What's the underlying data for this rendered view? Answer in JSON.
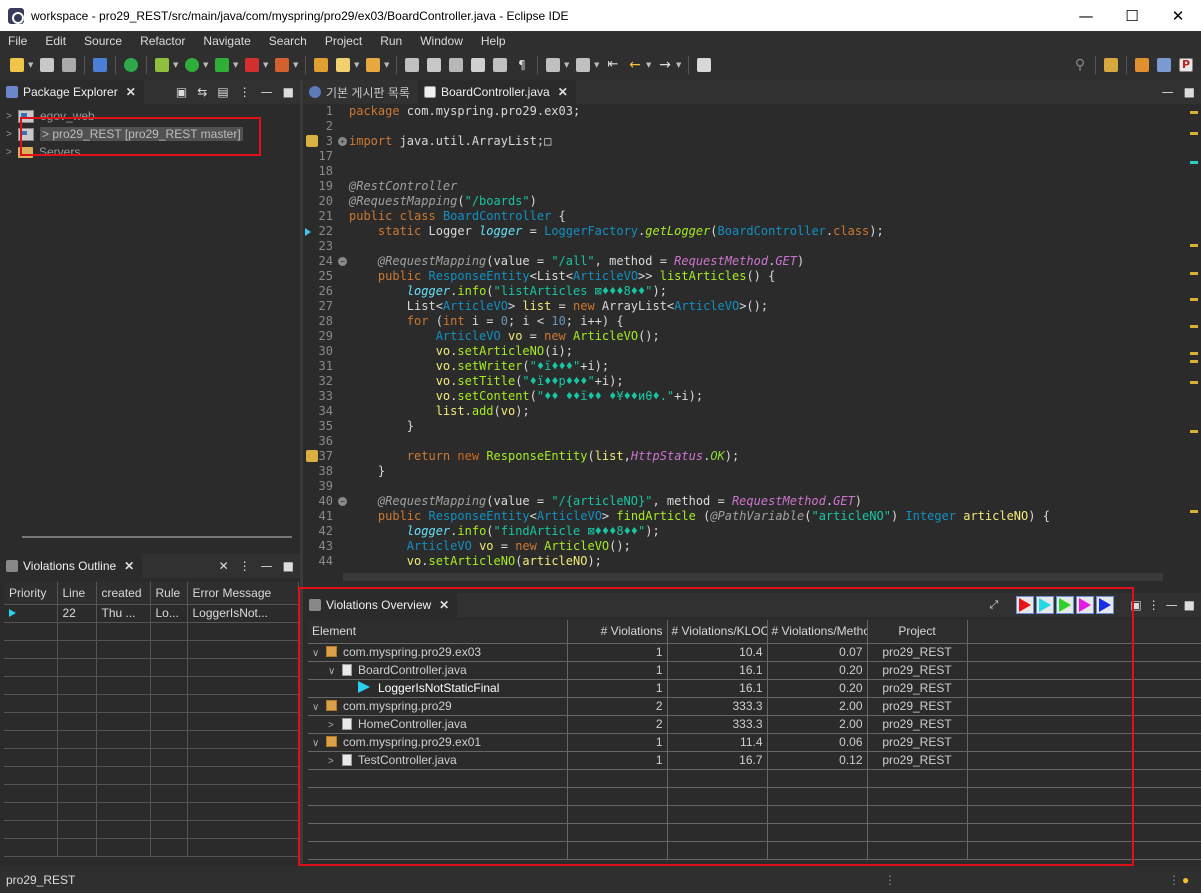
{
  "window": {
    "title": "workspace - pro29_REST/src/main/java/com/myspring/pro29/ex03/BoardController.java - Eclipse IDE",
    "minimize": "—",
    "maximize": "☐",
    "close": "✕"
  },
  "menu": [
    "File",
    "Edit",
    "Source",
    "Refactor",
    "Navigate",
    "Search",
    "Project",
    "Run",
    "Window",
    "Help"
  ],
  "package_explorer": {
    "tab_label": "Package Explorer",
    "items": [
      {
        "label": "egov_web"
      },
      {
        "label": "> pro29_REST [pro29_REST master]"
      },
      {
        "label": "Servers"
      }
    ]
  },
  "violations_outline": {
    "tab_label": "Violations Outline",
    "columns": [
      "Priority",
      "Line",
      "created",
      "Rule",
      "Error Message"
    ],
    "rows": [
      {
        "priority": "",
        "line": "22",
        "created": "Thu ...",
        "rule": "Lo...",
        "message": "LoggerIsNot..."
      }
    ]
  },
  "editor": {
    "tabs": [
      {
        "label": "기본 게시판 목록"
      },
      {
        "label": "BoardController.java"
      }
    ],
    "lines": [
      {
        "n": "1",
        "html": "<span class='kw'>package</span> com.myspring.pro29.ex03;"
      },
      {
        "n": "2",
        "html": ""
      },
      {
        "n": "3",
        "html": "<span class='kw'>import</span> java.util.ArrayList;&#9633;"
      },
      {
        "n": "17",
        "html": ""
      },
      {
        "n": "18",
        "html": ""
      },
      {
        "n": "19",
        "html": "<span class='an'>@RestController</span>"
      },
      {
        "n": "20",
        "html": "<span class='an'>@RequestMapping</span>(<span class='str'>\"/boards\"</span>)"
      },
      {
        "n": "21",
        "html": "<span class='kw'>public</span> <span class='kw'>class</span> <span class='cls'>BoardController</span> {"
      },
      {
        "n": "22",
        "html": "    <span class='kw'>static</span> Logger <span class='fld'>logger</span> = <span class='ty'>LoggerFactory</span>.<span class='mth2'>getLogger</span>(<span class='ty'>BoardController</span>.<span class='kw'>class</span>);"
      },
      {
        "n": "23",
        "html": ""
      },
      {
        "n": "24",
        "html": "    <span class='an'>@RequestMapping</span>(value = <span class='str'>\"/all\"</span>, method = <span class='it'>RequestMethod</span>.<span class='it'>GET</span>)"
      },
      {
        "n": "25",
        "html": "    <span class='kw'>public</span> <span class='ty'>ResponseEntity</span>&lt;List&lt;<span class='ty'>ArticleVO</span>&gt;&gt; <span class='mth'>listArticles</span>() {"
      },
      {
        "n": "26",
        "html": "        <span class='fld'>logger</span>.<span class='mth'>info</span>(<span class='str'>\"listArticles &#8864;&#9830;&#9830;&#9830;8&#9830;&#9830;\"</span>);"
      },
      {
        "n": "27",
        "html": "        List&lt;<span class='ty'>ArticleVO</span>&gt; <span class='var'>list</span> = <span class='kw'>new</span> ArrayList&lt;<span class='ty'>ArticleVO</span>&gt;();"
      },
      {
        "n": "28",
        "html": "        <span class='kw'>for</span> (<span class='kw'>int</span> i = <span class='num'>0</span>; i &lt; <span class='num'>10</span>; i++) {"
      },
      {
        "n": "29",
        "html": "            <span class='ty'>ArticleVO</span> <span class='var'>vo</span> = <span class='kw'>new</span> <span class='mth'>ArticleVO</span>();"
      },
      {
        "n": "30",
        "html": "            <span class='var'>vo</span>.<span class='mth'>setArticleNO</span>(i);"
      },
      {
        "n": "31",
        "html": "            <span class='var'>vo</span>.<span class='mth'>setWriter</span>(<span class='str'>\"&#9830;&#1111;&#9830;&#9830;&#9830;\"</span>+i);"
      },
      {
        "n": "32",
        "html": "            <span class='var'>vo</span>.<span class='mth'>setTitle</span>(<span class='str'>\"&#9830;&#1111;&#9830;&#9830;p&#9830;&#9830;&#9830;\"</span>+i);"
      },
      {
        "n": "33",
        "html": "            <span class='var'>vo</span>.<span class='mth'>setContent</span>(<span class='str'>\"&#9830;&#9830; &#9830;&#9830;&#1111;&#9830;&#9830; &#9830;&#165;&#9830;&#9830;&#1080;&#952;&#9830;.\"</span>+i);"
      },
      {
        "n": "34",
        "html": "            <span class='var'>list</span>.<span class='mth'>add</span>(<span class='var'>vo</span>);"
      },
      {
        "n": "35",
        "html": "        }"
      },
      {
        "n": "36",
        "html": ""
      },
      {
        "n": "37",
        "html": "        <span class='kw'>return</span> <span class='kw2'>new</span> <span class='mth'>ResponseEntity</span>(<span class='var'>list</span>,<span class='it'>HttpStatus</span>.<span class='enum'>OK</span>);"
      },
      {
        "n": "38",
        "html": "    }"
      },
      {
        "n": "39",
        "html": ""
      },
      {
        "n": "40",
        "html": "    <span class='an'>@RequestMapping</span>(value = <span class='str'>\"/{articleNO}\"</span>, method = <span class='it'>RequestMethod</span>.<span class='it'>GET</span>)"
      },
      {
        "n": "41",
        "html": "    <span class='kw'>public</span> <span class='ty'>ResponseEntity</span>&lt;<span class='ty'>ArticleVO</span>&gt; <span class='mth'>findArticle</span> (<span class='an'>@PathVariable</span>(<span class='str'>\"articleNO\"</span>) <span class='ty'>Integer</span> <span class='var'>articleNO</span>) {"
      },
      {
        "n": "42",
        "html": "        <span class='fld'>logger</span>.<span class='mth'>info</span>(<span class='str'>\"findArticle &#8864;&#9830;&#9830;&#9830;8&#9830;&#9830;\"</span>);"
      },
      {
        "n": "43",
        "html": "        <span class='ty'>ArticleVO</span> <span class='var'>vo</span> = <span class='kw'>new</span> <span class='mth'>ArticleVO</span>();"
      },
      {
        "n": "44",
        "html": "        <span class='var'>vo</span>.<span class='mth'>setArticleNO</span>(<span class='var'>articleNO</span>);"
      }
    ]
  },
  "violations_overview": {
    "tab_label": "Violations Overview",
    "columns": [
      "Element",
      "# Violations",
      "# Violations/KLOC",
      "# Violations/Method",
      "Project"
    ],
    "rows": [
      {
        "depth": 0,
        "expander": "∨",
        "icon": "package",
        "element": "com.myspring.pro29.ex03",
        "violations": "1",
        "per_kloc": "10.4",
        "per_method": "0.07",
        "project": "pro29_REST"
      },
      {
        "depth": 1,
        "expander": "∨",
        "icon": "file",
        "element": "BoardController.java",
        "violations": "1",
        "per_kloc": "16.1",
        "per_method": "0.20",
        "project": "pro29_REST"
      },
      {
        "depth": 2,
        "expander": "",
        "icon": "rule",
        "element": "LoggerIsNotStaticFinal",
        "violations": "1",
        "per_kloc": "16.1",
        "per_method": "0.20",
        "project": "pro29_REST"
      },
      {
        "depth": 0,
        "expander": "∨",
        "icon": "package",
        "element": "com.myspring.pro29",
        "violations": "2",
        "per_kloc": "333.3",
        "per_method": "2.00",
        "project": "pro29_REST"
      },
      {
        "depth": 1,
        "expander": ">",
        "icon": "file",
        "element": "HomeController.java",
        "violations": "2",
        "per_kloc": "333.3",
        "per_method": "2.00",
        "project": "pro29_REST"
      },
      {
        "depth": 0,
        "expander": "∨",
        "icon": "package",
        "element": "com.myspring.pro29.ex01",
        "violations": "1",
        "per_kloc": "11.4",
        "per_method": "0.06",
        "project": "pro29_REST"
      },
      {
        "depth": 1,
        "expander": ">",
        "icon": "file",
        "element": "TestController.java",
        "violations": "1",
        "per_kloc": "16.7",
        "per_method": "0.12",
        "project": "pro29_REST"
      }
    ],
    "priority_filter_colors": [
      "#e8141b",
      "#25d8e8",
      "#2ed12a",
      "#e41ae4",
      "#1a2ee8"
    ]
  },
  "status_bar": {
    "text": "pro29_REST"
  }
}
